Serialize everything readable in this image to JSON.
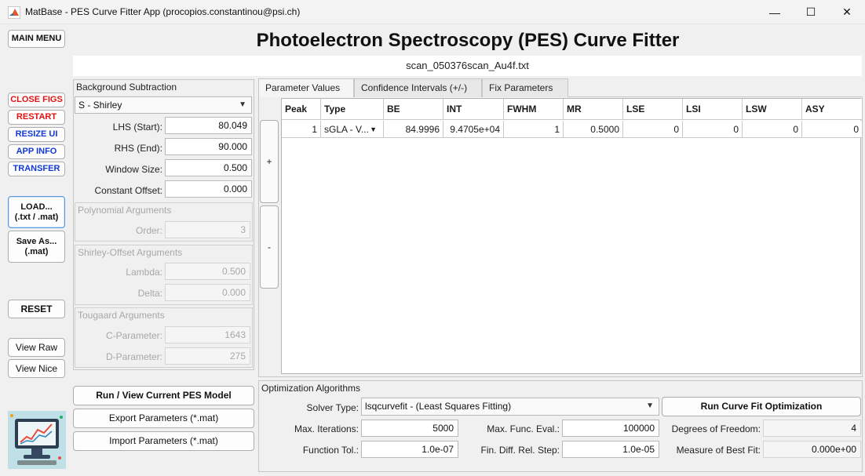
{
  "window": {
    "title": "MatBase - PES Curve Fitter App (procopios.constantinou@psi.ch)",
    "minimize": "—",
    "maximize": "☐",
    "close": "✕"
  },
  "app": {
    "title": "Photoelectron Spectroscopy (PES) Curve Fitter",
    "filename": "scan_050376scan_Au4f.txt"
  },
  "left_menu": {
    "main_menu": "MAIN MENU",
    "close_figs": "CLOSE FIGS",
    "restart": "RESTART",
    "resize_ui": "RESIZE UI",
    "app_info": "APP INFO",
    "transfer": "TRANSFER",
    "load_line1": "LOAD...",
    "load_line2": "(.txt / .mat)",
    "saveas_line1": "Save As...",
    "saveas_line2": "(.mat)",
    "reset": "RESET",
    "view_raw": "View Raw",
    "view_nice": "View Nice"
  },
  "background": {
    "title": "Background Subtraction",
    "method": "S - Shirley",
    "lhs_label": "LHS (Start):",
    "lhs_value": "80.049",
    "rhs_label": "RHS (End):",
    "rhs_value": "90.000",
    "window_label": "Window Size:",
    "window_value": "0.500",
    "offset_label": "Constant Offset:",
    "offset_value": "0.000",
    "poly_title": "Polynomial Arguments",
    "order_label": "Order:",
    "order_value": "3",
    "shirley_title": "Shirley-Offset Arguments",
    "lambda_label": "Lambda:",
    "lambda_value": "0.500",
    "delta_label": "Delta:",
    "delta_value": "0.000",
    "tougaard_title": "Tougaard Arguments",
    "c_label": "C-Parameter:",
    "c_value": "1643",
    "d_label": "D-Parameter:",
    "d_value": "275"
  },
  "actions": {
    "run_model": "Run / View Current PES Model",
    "export": "Export Parameters (*.mat)",
    "import": "Import Parameters (*.mat)"
  },
  "tabs": [
    "Parameter Values",
    "Confidence Intervals (+/-)",
    "Fix Parameters"
  ],
  "table": {
    "add": "+",
    "remove": "-",
    "headers": [
      "Peak",
      "Type",
      "BE",
      "INT",
      "FWHM",
      "MR",
      "LSE",
      "LSI",
      "LSW",
      "ASY"
    ],
    "row": [
      "1",
      "sGLA - V...",
      "84.9996",
      "9.4705e+04",
      "1",
      "0.5000",
      "0",
      "0",
      "0",
      "0"
    ]
  },
  "optimization": {
    "title": "Optimization Algorithms",
    "solver_label": "Solver Type:",
    "solver_value": "lsqcurvefit - (Least Squares Fitting)",
    "run": "Run Curve Fit Optimization",
    "max_iter_label": "Max. Iterations:",
    "max_iter_value": "5000",
    "max_func_label": "Max. Func. Eval.:",
    "max_func_value": "100000",
    "dof_label": "Degrees of Freedom:",
    "dof_value": "4",
    "ftol_label": "Function Tol.:",
    "ftol_value": "1.0e-07",
    "fdiff_label": "Fin. Diff. Rel. Step:",
    "fdiff_value": "1.0e-05",
    "fit_label": "Measure of Best Fit:",
    "fit_value": "0.000e+00"
  },
  "colors": {
    "danger": "#e01212",
    "link": "#1239d6",
    "accent": "#5b9bd5"
  }
}
